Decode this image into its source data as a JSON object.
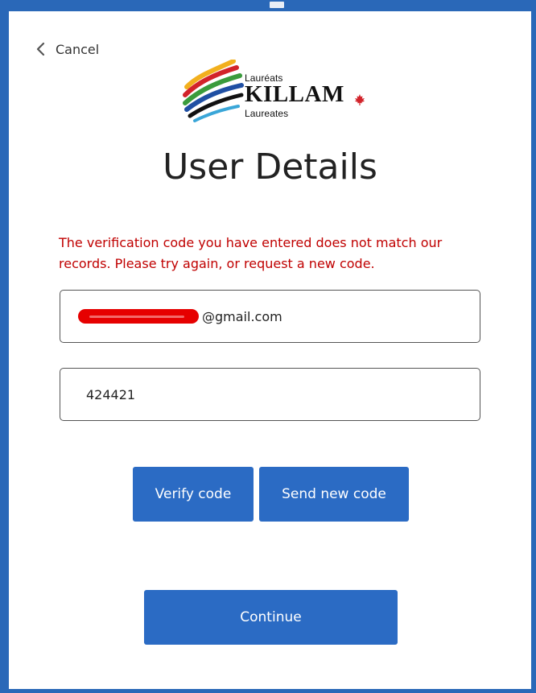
{
  "header": {
    "cancel_label": "Cancel"
  },
  "logo": {
    "line_top": "Lauréats",
    "line_main": "KILLAM",
    "line_bottom": "Laureates",
    "icon": "killam-stripes-logo",
    "maple_icon": "maple-leaf-icon"
  },
  "page": {
    "title": "User Details"
  },
  "error": {
    "message": "The verification code you have entered does not match our records. Please try again, or request a new code."
  },
  "form": {
    "email_suffix": "@gmail.com",
    "code_value": "424421"
  },
  "buttons": {
    "verify_label": "Verify code",
    "send_new_label": "Send new code",
    "continue_label": "Continue"
  },
  "colors": {
    "accent": "#2b6bc4",
    "error": "#c00000",
    "border": "#2a68b8",
    "maple": "#d2232a"
  }
}
